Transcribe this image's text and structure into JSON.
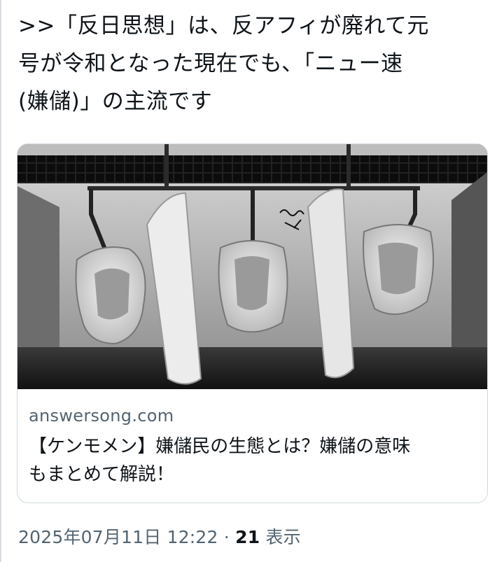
{
  "tweet": {
    "text": ">>「反日思想」は、反アフィが廃れて元\n号が令和となった現在でも、「ニュー速\n(嫌儲)」の主流です"
  },
  "card": {
    "image_description": "Black-and-white photo of three urinals separated by two partitions",
    "domain": "answersong.com",
    "title": "【ケンモメン】嫌儲民の生態とは？嫌儲の意味\nもまとめて解説！"
  },
  "meta": {
    "timestamp": "2025年07月11日 12:22",
    "separator": " · ",
    "views_count": "21",
    "views_label": " 表示"
  },
  "colors": {
    "text_primary": "#0f1419",
    "text_secondary": "#536471",
    "card_border": "#cfd9de"
  }
}
